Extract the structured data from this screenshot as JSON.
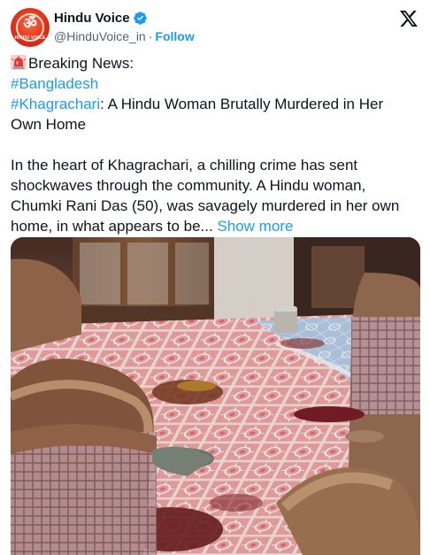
{
  "account": {
    "display_name": "Hindu Voice",
    "handle": "@HinduVoice_in",
    "follow_label": "Follow",
    "separator": "·",
    "avatar_text": "HINDU VOICE",
    "avatar_icon": "om-symbol-icon"
  },
  "tweet": {
    "line1": "Breaking News:",
    "hashtag_bangladesh": "#Bangladesh",
    "hashtag_khagrachari": "#Khagrachari",
    "headline_rest": ": A Hindu Woman Brutally Murdered in Her",
    "headline_line2": "Own Home",
    "para_line1": "In the heart of Khagrachari, a chilling crime has sent",
    "para_line2": "shockwaves through the community. A Hindu woman,",
    "para_line3": "Chumki Rani Das (50), was savagely murdered in her own",
    "para_line4": "home, in what appears to be...",
    "show_more": "Show more"
  },
  "icons": {
    "verified": "verified-badge-icon",
    "platform": "x-logo-icon",
    "siren": "police-siren-icon"
  },
  "colors": {
    "accent": "#1d9bf0",
    "text": "#0f1419",
    "muted": "#536471"
  }
}
